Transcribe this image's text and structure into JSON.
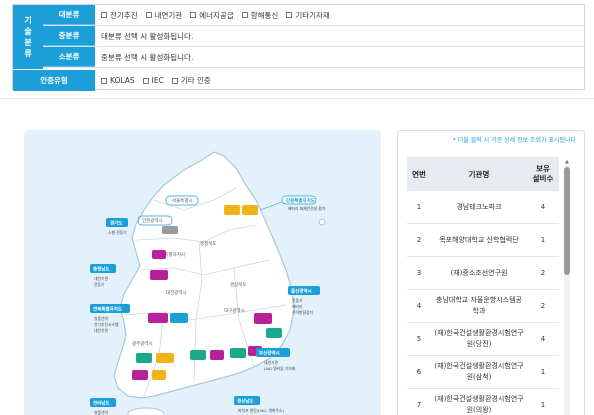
{
  "filter": {
    "vertical_label": [
      "기",
      "술",
      "분",
      "류"
    ],
    "major": {
      "label": "대분류",
      "options": [
        "전기추진",
        "내연기관",
        "에너지공급",
        "항해통신",
        "기타기자재"
      ]
    },
    "middle": {
      "label": "중분류",
      "text": "대분류 선택 시 활성화됩니다."
    },
    "minor": {
      "label": "소분류",
      "text": "중분류 선택 시 활성화됩니다."
    },
    "cert": {
      "label": "인증유형",
      "options": [
        "KOLAS",
        "IEC",
        "기타 인증"
      ]
    }
  },
  "map": {
    "regions": {
      "seoul": "서울특별시",
      "incheon": "인천광역시",
      "gyeonggi": "경기도",
      "gangwon": "강원특별자치도",
      "chungbuk": "충청북도",
      "chungnam": "충청남도",
      "sejong": "세종특별자치시",
      "daejeon": "대전광역시",
      "jeonbuk": "전북특별자치도",
      "gyeongbuk": "경상북도",
      "daegu": "대구광역시",
      "ulsan": "울산광역시",
      "gwangju": "광주광역시",
      "busan": "부산광역시",
      "gyeongnam": "경상남도",
      "jeonnam": "전라남도"
    },
    "callouts": {
      "gangwon": {
        "title": "강원특별자치도",
        "items": [
          "배터리 화재안전성 평가"
        ]
      },
      "gyeonggi": {
        "title": "경기도",
        "items": [
          "소형 전동기"
        ]
      },
      "chungnam": {
        "title": "충청남도",
        "items": [
          "내연기관",
          "전동기"
        ]
      },
      "jeonbuk": {
        "title": "전북특별자치도",
        "items": [
          "실증선박",
          "전기추진시스템",
          "내연기관"
        ]
      },
      "ulsan": {
        "title": "울산광역시",
        "items": [
          "전동기",
          "배터리",
          "전력변환장치"
        ]
      },
      "busan": {
        "title": "부산광역시",
        "items": [
          "내연기관",
          "LNG 탱커및 기자재"
        ]
      },
      "jeonnam": {
        "title": "전라남도",
        "items": [
          "실증선박"
        ]
      },
      "gyeongnam": {
        "title": "경상남도",
        "items": [
          "피치프 엔진(LNG, 액화수소)"
        ]
      }
    }
  },
  "table": {
    "note": "* 더블 클릭 시 기관 상세 정보 조회가 표시됩니다",
    "headers": {
      "no": "연번",
      "name": "기관명",
      "count_line1": "보유",
      "count_line2": "설비수"
    },
    "rows": [
      {
        "no": "1",
        "name": "경남테크노파크",
        "count": "4"
      },
      {
        "no": "2",
        "name": "목포해양대학교 산학협력단",
        "count": "1"
      },
      {
        "no": "3",
        "name": "(재)중소조선연구원",
        "count": "2"
      },
      {
        "no": "4",
        "name": "충남대학교 자율운항시스템공학과",
        "count": "2"
      },
      {
        "no": "5",
        "name": "(재)한국건설생활환경시험연구원(당진)",
        "count": "4"
      },
      {
        "no": "6",
        "name": "(재)한국건설생활환경시험연구원(삼척)",
        "count": "1"
      },
      {
        "no": "7",
        "name": "(재)한국건설생활환경시험연구원(의왕)",
        "count": "1"
      }
    ]
  },
  "colors": {
    "accent": "#1c9fd9",
    "land": "#ffffff",
    "sea": "#e3f1fb",
    "callout_blue": "#1c9fd9",
    "magenta": "#b9219a",
    "teal": "#1aa98a",
    "yellow": "#f1b417"
  }
}
